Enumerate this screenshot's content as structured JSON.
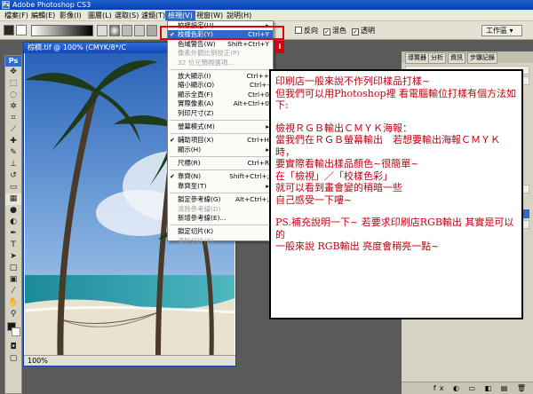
{
  "window": {
    "title": "Adobe Photoshop CS3",
    "app_icon": "Ps"
  },
  "menubar": [
    {
      "label": "檔案(F)",
      "active": false
    },
    {
      "label": "編輯(E)",
      "active": false
    },
    {
      "label": "影像(I)",
      "active": false
    },
    {
      "label": "圖層(L)",
      "active": false
    },
    {
      "label": "選取(S)",
      "active": false
    },
    {
      "label": "濾鏡(T)",
      "active": false
    },
    {
      "label": "檢視(V)",
      "active": true
    },
    {
      "label": "視窗(W)",
      "active": false
    },
    {
      "label": "說明(H)",
      "active": false
    }
  ],
  "options_bar": {
    "reverse_label": "反向",
    "reverse_checked": false,
    "dither_label": "混色",
    "dither_checked": true,
    "transparency_label": "透明",
    "transparency_checked": true,
    "workspace_label": "工作區"
  },
  "toolbox": {
    "header": "Ps"
  },
  "document": {
    "title": "棕櫚.tif @ 100% (CMYK/8*/C",
    "zoom": "100%"
  },
  "view_menu": {
    "items": [
      {
        "label": "校樣設定(U)",
        "shortcut": "",
        "checked": false,
        "disabled": false,
        "highlight": false,
        "submenu": true
      },
      {
        "label": "校樣色彩(Y)",
        "shortcut": "Ctrl+Y",
        "checked": true,
        "disabled": false,
        "highlight": true,
        "submenu": false
      },
      {
        "label": "色域警告(W)",
        "shortcut": "Shift+Ctrl+Y",
        "checked": false,
        "disabled": false,
        "highlight": false,
        "submenu": false
      },
      {
        "label": "像素外觀比例校正(P)",
        "shortcut": "",
        "checked": false,
        "disabled": true,
        "highlight": false,
        "submenu": false
      },
      {
        "label": "32 位元預視選項...",
        "shortcut": "",
        "checked": false,
        "disabled": true,
        "highlight": false,
        "submenu": false
      },
      {
        "sep": true
      },
      {
        "label": "放大顯示(I)",
        "shortcut": "Ctrl++",
        "checked": false,
        "disabled": false,
        "highlight": false,
        "submenu": false
      },
      {
        "label": "縮小顯示(O)",
        "shortcut": "Ctrl+-",
        "checked": false,
        "disabled": false,
        "highlight": false,
        "submenu": false
      },
      {
        "label": "顯示全頁(F)",
        "shortcut": "Ctrl+0",
        "checked": false,
        "disabled": false,
        "highlight": false,
        "submenu": false
      },
      {
        "label": "實際像素(A)",
        "shortcut": "Alt+Ctrl+0",
        "checked": false,
        "disabled": false,
        "highlight": false,
        "submenu": false
      },
      {
        "label": "列印尺寸(Z)",
        "shortcut": "",
        "checked": false,
        "disabled": false,
        "highlight": false,
        "submenu": false
      },
      {
        "sep": true
      },
      {
        "label": "螢幕模式(M)",
        "shortcut": "",
        "checked": false,
        "disabled": false,
        "highlight": false,
        "submenu": true
      },
      {
        "sep": true
      },
      {
        "label": "輔助項目(X)",
        "shortcut": "Ctrl+H",
        "checked": true,
        "disabled": false,
        "highlight": false,
        "submenu": false
      },
      {
        "label": "顯示(H)",
        "shortcut": "",
        "checked": false,
        "disabled": false,
        "highlight": false,
        "submenu": true
      },
      {
        "sep": true
      },
      {
        "label": "尺標(R)",
        "shortcut": "Ctrl+R",
        "checked": false,
        "disabled": false,
        "highlight": false,
        "submenu": false
      },
      {
        "sep": true
      },
      {
        "label": "靠齊(N)",
        "shortcut": "Shift+Ctrl+;",
        "checked": true,
        "disabled": false,
        "highlight": false,
        "submenu": false
      },
      {
        "label": "靠齊至(T)",
        "shortcut": "",
        "checked": false,
        "disabled": false,
        "highlight": false,
        "submenu": true
      },
      {
        "sep": true
      },
      {
        "label": "鎖定參考線(G)",
        "shortcut": "Alt+Ctrl+;",
        "checked": false,
        "disabled": false,
        "highlight": false,
        "submenu": false
      },
      {
        "label": "清除參考線(D)",
        "shortcut": "",
        "checked": false,
        "disabled": true,
        "highlight": false,
        "submenu": false
      },
      {
        "label": "新增參考線(E)...",
        "shortcut": "",
        "checked": false,
        "disabled": false,
        "highlight": false,
        "submenu": false
      },
      {
        "sep": true
      },
      {
        "label": "鎖定切片(K)",
        "shortcut": "",
        "checked": false,
        "disabled": false,
        "highlight": false,
        "submenu": false
      },
      {
        "label": "清除切片(C)",
        "shortcut": "",
        "checked": false,
        "disabled": true,
        "highlight": false,
        "submenu": false
      }
    ]
  },
  "annotation_tag": "i",
  "right_panel": {
    "tabs": [
      "導覽器",
      "分析",
      "資訊",
      "步驟記錄"
    ],
    "footer_icons": "fx ◐ ▭ ◧ ▤ 🗑"
  },
  "note": {
    "p1": "印刷店一般來說不作列印樣品打樣~\n但我們可以用Photoshop裡 看電腦輸位打樣有個方法如下:",
    "p2": "檢視ＲＧＢ輸出ＣＭＹＫ海報：\n當我們在ＲＧＢ螢幕輸出　若想要輸出海報ＣＭＹＫ時，\n要實際看輸出樣品顏色~很簡單~\n在「檢視」／「校樣色彩」\n就可以看到畫會變的稍暗一些\n自己感受一下嘍~",
    "p3": "PS.補充說明一下~ 若要求印刷店RGB輸出 其實是可以的\n一般來說 RGB輸出 亮度會稍亮一點~"
  },
  "colors": {
    "highlight": "#3169c6",
    "annotation_red": "#e00010",
    "note_text": "#c00010"
  }
}
